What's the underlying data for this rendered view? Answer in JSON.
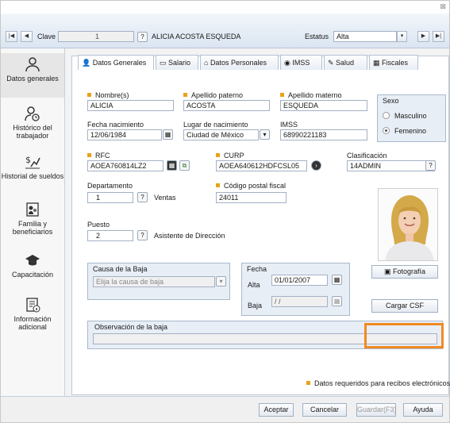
{
  "window": {
    "close_glyph": "⊠"
  },
  "nav": {
    "first": "|◀",
    "prev": "◀",
    "next": "▶",
    "last": "▶|",
    "clave_label": "Clave",
    "clave_value": "1",
    "employee_name": "ALICIA ACOSTA ESQUEDA",
    "estatus_label": "Estatus",
    "estatus_value": "Alta"
  },
  "sidebar": {
    "items": [
      {
        "label": "Datos generales",
        "icon": "person-icon"
      },
      {
        "label": "Histórico del trabajador",
        "icon": "person-history-icon"
      },
      {
        "label": "Historial de sueldos",
        "icon": "salary-chart-icon"
      },
      {
        "label": "Familia y beneficiarios",
        "icon": "family-icon"
      },
      {
        "label": "Capacitación",
        "icon": "graduation-cap-icon"
      },
      {
        "label": "Información adicional",
        "icon": "info-document-icon"
      }
    ]
  },
  "tabs": [
    {
      "label": "Datos Generales",
      "icon": "person-icon"
    },
    {
      "label": "Salario",
      "icon": "money-icon"
    },
    {
      "label": "Datos Personales",
      "icon": "home-icon"
    },
    {
      "label": "IMSS",
      "icon": "imss-icon"
    },
    {
      "label": "Salud",
      "icon": "syringe-icon"
    },
    {
      "label": "Fiscales",
      "icon": "grid-icon"
    }
  ],
  "form": {
    "nombre_label": "Nombre(s)",
    "nombre": "ALICIA",
    "paterno_label": "Apellido paterno",
    "paterno": "ACOSTA",
    "materno_label": "Apellido materno",
    "materno": "ESQUEDA",
    "sexo_title": "Sexo",
    "masculino": "Masculino",
    "femenino": "Femenino",
    "fecha_nac_label": "Fecha nacimiento",
    "fecha_nac": "12/06/1984",
    "lugar_label": "Lugar de nacimiento",
    "lugar": "Ciudad de México",
    "imss_label": "IMSS",
    "imss": "68990221183",
    "rfc_label": "RFC",
    "rfc": "AOEA760814LZ2",
    "curp_label": "CURP",
    "curp": "AOEA640612HDFCSL05",
    "clasificacion_label": "Clasificación",
    "clasificacion": "14ADMIN",
    "departamento_label": "Departamento",
    "departamento": "1",
    "departamento_name": "Ventas",
    "cp_label": "Código postal fiscal",
    "cp": "24011",
    "puesto_label": "Puesto",
    "puesto": "2",
    "puesto_name": "Asistente de Dirección",
    "baja_title": "Causa de la Baja",
    "baja_placeholder": "Elija la causa de baja",
    "fecha_title": "Fecha",
    "alta_label": "Alta",
    "alta": "01/01/2007",
    "baja_label": "Baja",
    "baja": " / /",
    "fotografia": "Fotografía",
    "cargar_csf": "Cargar CSF",
    "observacion_label": "Observación de la baja",
    "required_note": "Datos requeridos para recibos electrónicos"
  },
  "footer": {
    "aceptar": "Aceptar",
    "cancelar": "Cancelar",
    "guardar": "Guardar(F3)",
    "ayuda": "Ayuda"
  },
  "colors": {
    "required": "#e8a317",
    "highlight": "#f08a24"
  }
}
